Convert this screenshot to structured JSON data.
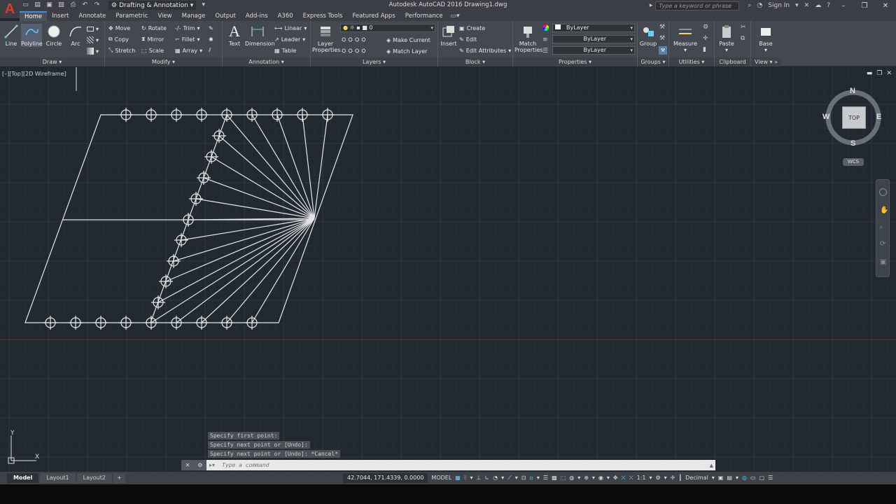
{
  "window": {
    "app_title": "Autodesk AutoCAD 2016",
    "file_name": "Drawing1.dwg",
    "workspace": "Drafting & Annotation",
    "search_placeholder": "Type a keyword or phrase",
    "sign_in": "Sign In"
  },
  "tabs": [
    "Home",
    "Insert",
    "Annotate",
    "Parametric",
    "View",
    "Manage",
    "Output",
    "Add-ins",
    "A360",
    "Express Tools",
    "Featured Apps",
    "Performance"
  ],
  "ribbon": {
    "draw": {
      "title": "Draw",
      "line": "Line",
      "polyline": "Polyline",
      "circle": "Circle",
      "arc": "Arc"
    },
    "modify": {
      "title": "Modify",
      "move": "Move",
      "rotate": "Rotate",
      "trim": "Trim",
      "copy": "Copy",
      "mirror": "Mirror",
      "fillet": "Fillet",
      "stretch": "Stretch",
      "scale": "Scale",
      "array": "Array"
    },
    "annotation": {
      "title": "Annotation",
      "text": "Text",
      "dimension": "Dimension",
      "linear": "Linear",
      "leader": "Leader",
      "table": "Table"
    },
    "layers": {
      "title": "Layers",
      "layer_properties_1": "Layer",
      "layer_properties_2": "Properties",
      "current_layer": "0",
      "make_current": "Make Current",
      "match_layer": "Match Layer"
    },
    "block": {
      "title": "Block",
      "insert": "Insert",
      "create": "Create",
      "edit": "Edit",
      "edit_attributes": "Edit Attributes"
    },
    "properties": {
      "title": "Properties",
      "match_1": "Match",
      "match_2": "Properties",
      "color": "ByLayer",
      "linetype": "ByLayer",
      "lineweight": "ByLayer"
    },
    "groups": {
      "title": "Groups",
      "group": "Group"
    },
    "utilities": {
      "title": "Utilities",
      "measure": "Measure"
    },
    "clipboard": {
      "title": "Clipboard",
      "paste": "Paste"
    },
    "view": {
      "title": "View",
      "base": "Base"
    }
  },
  "viewport": {
    "label": "[–][Top][2D Wireframe]",
    "viewcube": {
      "north": "N",
      "south": "S",
      "east": "E",
      "west": "W",
      "face": "TOP",
      "wcs": "WCS"
    },
    "ucs": {
      "x": "X",
      "y": "Y"
    }
  },
  "command": {
    "history": [
      "Specify first point:",
      "Specify next point or [Undo]:",
      "Specify next point or [Undo]: *Cancel*"
    ],
    "placeholder": "Type a command"
  },
  "status": {
    "layouts": [
      "Model",
      "Layout1",
      "Layout2"
    ],
    "add_layout": "+",
    "coordinates": "42.7044, 171.4339, 0.0000",
    "space": "MODEL",
    "scale": "1:1",
    "units": "Decimal"
  },
  "colors": {
    "background": "#212830",
    "ribbon": "#444951",
    "accent": "#3a8ee6",
    "linework": "#e6e6e6",
    "x_axis": "#8a2a2a"
  }
}
